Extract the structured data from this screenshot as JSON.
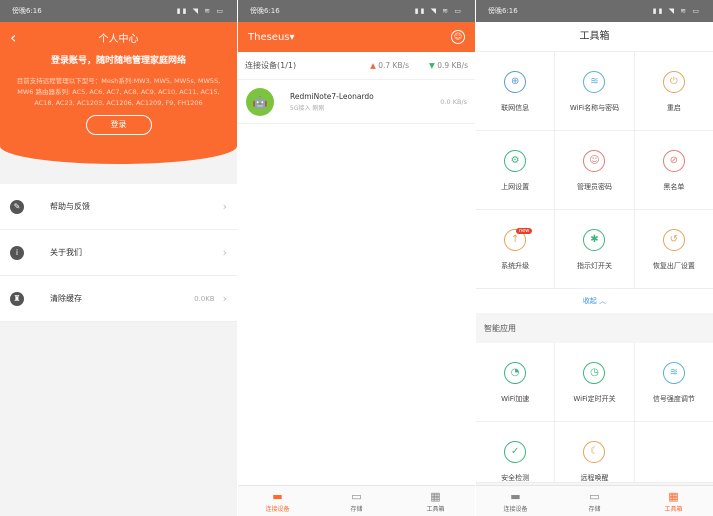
{
  "status": {
    "time": "傍晚6:16",
    "battery": "40"
  },
  "profile": {
    "title": "个人中心",
    "slogan": "登录账号，随时随地管理家庭网络",
    "desc": "目前支持远程管理以下型号：Mesh系列:MW3, MW5, MW5s, MW5S, MW6 路由器系列: AC5, AC6, AC7, AC8, AC9, AC10, AC11, AC15, AC18, AC23, AC1203, AC1206, AC1209, F9, FH1206",
    "login": "登录",
    "menu": [
      {
        "label": "帮助与反馈",
        "icon": "edit-icon",
        "value": ""
      },
      {
        "label": "关于我们",
        "icon": "info-icon",
        "value": ""
      },
      {
        "label": "清除缓存",
        "icon": "broom-icon",
        "value": "0.0KB"
      }
    ]
  },
  "devices": {
    "network": "Theseus",
    "section": "连接设备(1/1)",
    "up": "0.7 KB/s",
    "down": "0.9 KB/s",
    "list": [
      {
        "name": "RedmiNote7-Leonardo",
        "sub": "5G接入    刚刚",
        "speed": "0.0 KB/s"
      }
    ],
    "nav": [
      "连接设备",
      "存储",
      "工具箱"
    ]
  },
  "tools": {
    "title": "工具箱",
    "items": [
      {
        "label": "联网信息",
        "color": "#5a9bd5",
        "glyph": "⊕"
      },
      {
        "label": "WiFi名称与密码",
        "color": "#5aaee0",
        "glyph": "≋"
      },
      {
        "label": "重启",
        "color": "#e8a25a",
        "glyph": "⏻"
      },
      {
        "label": "上网设置",
        "color": "#3bb57b",
        "glyph": "⚙"
      },
      {
        "label": "管理员密码",
        "color": "#e07a7a",
        "glyph": "☺"
      },
      {
        "label": "黑名单",
        "color": "#e07a7a",
        "glyph": "⊘"
      },
      {
        "label": "系统升级",
        "color": "#e8a25a",
        "glyph": "↑"
      },
      {
        "label": "指示灯开关",
        "color": "#3bb57b",
        "glyph": "✱"
      },
      {
        "label": "恢复出厂设置",
        "color": "#e8a25a",
        "glyph": "↺"
      }
    ],
    "new_badge": "new",
    "collapse": "收起",
    "smart_title": "智能应用",
    "smart": [
      {
        "label": "WiFi加速",
        "color": "#3bb57b",
        "glyph": "◔"
      },
      {
        "label": "WiFi定时开关",
        "color": "#3bb57b",
        "glyph": "◷"
      },
      {
        "label": "信号强度调节",
        "color": "#5aaee0",
        "glyph": "≋"
      },
      {
        "label": "安全检测",
        "color": "#3bb57b",
        "glyph": "✓"
      },
      {
        "label": "远程唤醒",
        "color": "#e8a25a",
        "glyph": "☾"
      }
    ],
    "nav": [
      "连接设备",
      "存储",
      "工具箱"
    ]
  }
}
